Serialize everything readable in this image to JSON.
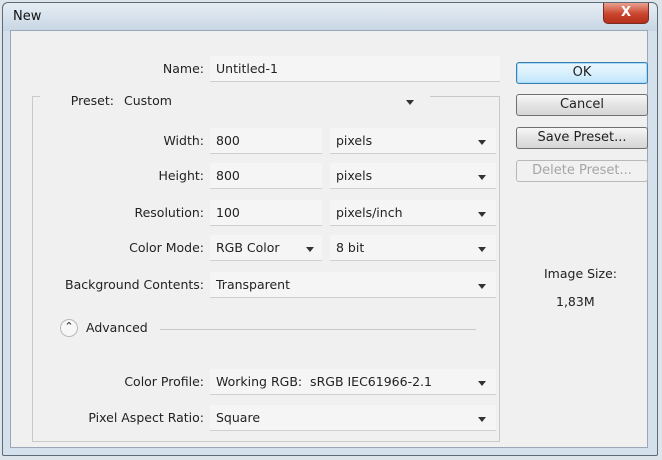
{
  "window": {
    "title": "New",
    "close_label": "X"
  },
  "form": {
    "name_label": "Name:",
    "name_value": "Untitled-1",
    "preset_label": "Preset:",
    "preset_value": "Custom",
    "width_label": "Width:",
    "width_value": "800",
    "width_unit": "pixels",
    "height_label": "Height:",
    "height_value": "800",
    "height_unit": "pixels",
    "resolution_label": "Resolution:",
    "resolution_value": "100",
    "resolution_unit": "pixels/inch",
    "color_mode_label": "Color Mode:",
    "color_mode_value": "RGB Color",
    "bit_depth_value": "8 bit",
    "background_label": "Background Contents:",
    "background_value": "Transparent",
    "advanced_label": "Advanced",
    "color_profile_label": "Color Profile:",
    "color_profile_value": "Working RGB:  sRGB IEC61966-2.1",
    "pixel_aspect_label": "Pixel Aspect Ratio:",
    "pixel_aspect_value": "Square"
  },
  "buttons": {
    "ok": "OK",
    "cancel": "Cancel",
    "save_preset": "Save Preset...",
    "delete_preset": "Delete Preset..."
  },
  "image_size": {
    "label": "Image Size:",
    "value": "1,83M"
  },
  "icons": {
    "advanced_toggle": "double-chevron-up-icon",
    "dropdown": "chevron-down-icon",
    "close": "close-icon"
  },
  "colors": {
    "titlebar": "#c7d6e4",
    "close_button": "#c9442d",
    "ok_button": "#bee6fd",
    "dialog_bg": "#f0f0f0"
  }
}
